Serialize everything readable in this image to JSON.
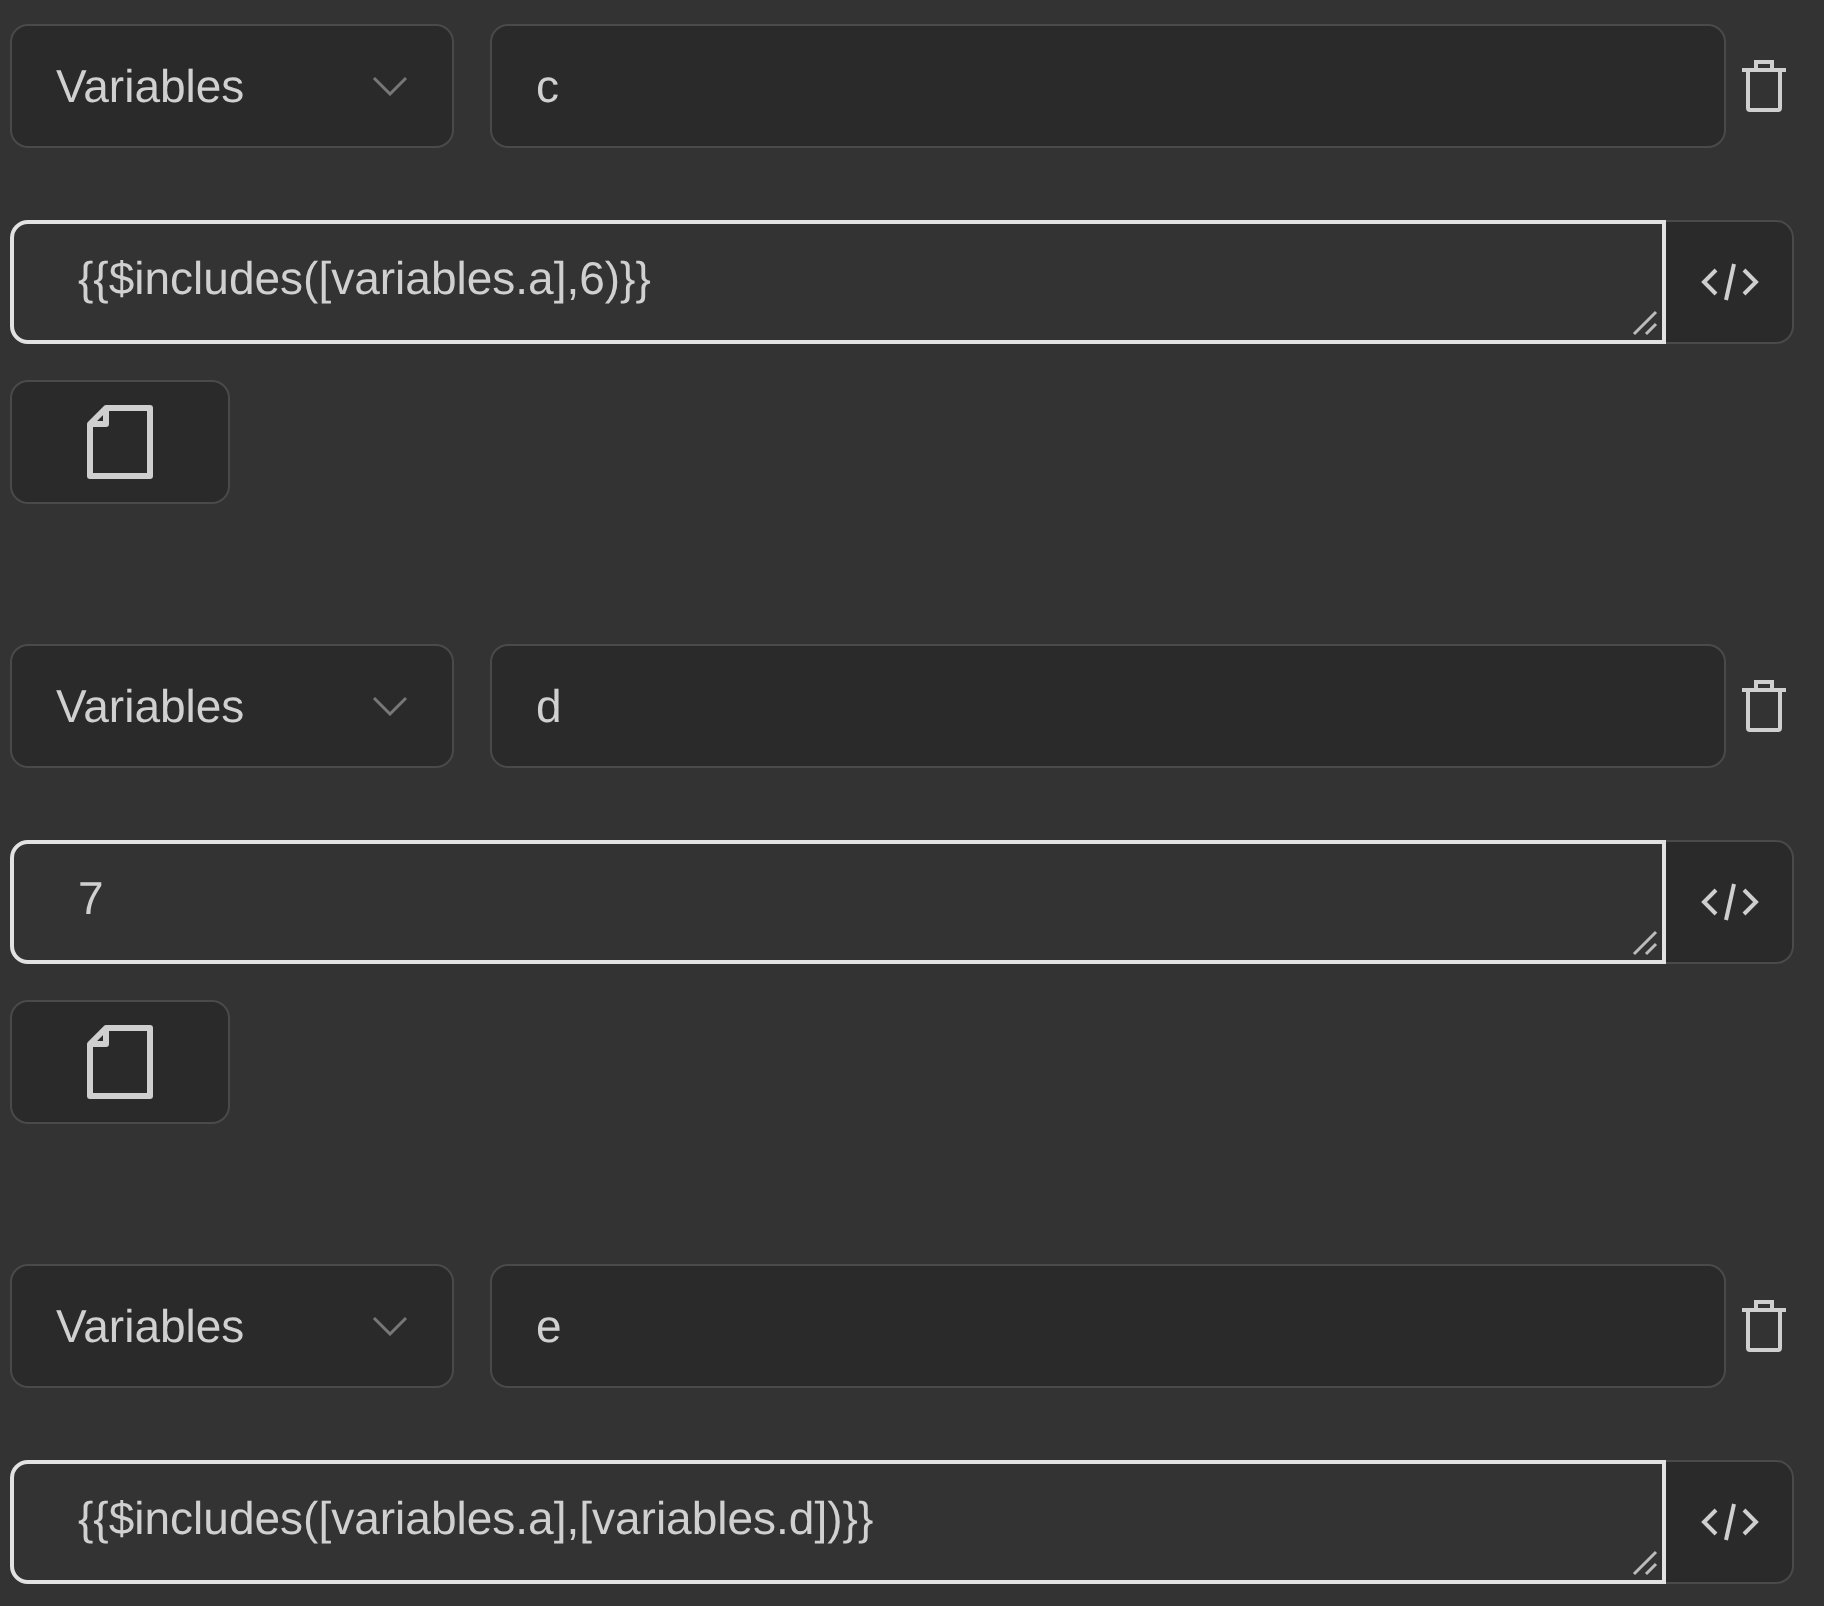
{
  "assignments": [
    {
      "source": "Variables",
      "name": "c",
      "value": "{{$includes([variables.a],6)}}",
      "focused": true,
      "page_button": true
    },
    {
      "source": "Variables",
      "name": "d",
      "value": "7",
      "focused": true,
      "page_button": true
    },
    {
      "source": "Variables",
      "name": "e",
      "value": "{{$includes([variables.a],[variables.d])}}",
      "focused": true,
      "page_button": false
    }
  ]
}
